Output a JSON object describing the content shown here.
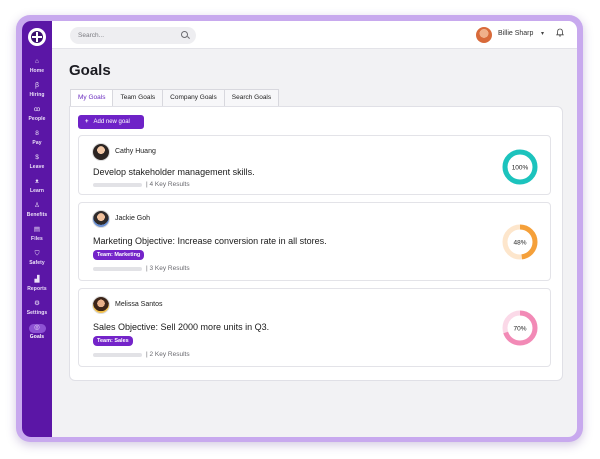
{
  "sidebar": {
    "items": [
      {
        "label": "Home",
        "icon": "home-icon",
        "glyph": "⌂"
      },
      {
        "label": "Hiring",
        "icon": "hiring-icon",
        "glyph": "ꞵ"
      },
      {
        "label": "People",
        "icon": "people-icon",
        "glyph": "ꝏ"
      },
      {
        "label": "Pay",
        "icon": "pay-icon",
        "glyph": "8"
      },
      {
        "label": "Leave",
        "icon": "leave-icon",
        "glyph": "$"
      },
      {
        "label": "Learn",
        "icon": "learn-icon",
        "glyph": "ᴥ"
      },
      {
        "label": "Benefits",
        "icon": "benefits-icon",
        "glyph": "♙"
      },
      {
        "label": "Files",
        "icon": "files-icon",
        "glyph": "▤"
      },
      {
        "label": "Safety",
        "icon": "safety-icon",
        "glyph": "⛉"
      },
      {
        "label": "Reports",
        "icon": "reports-icon",
        "glyph": "▟"
      },
      {
        "label": "Settings",
        "icon": "settings-icon",
        "glyph": "⚙"
      },
      {
        "label": "Goals",
        "icon": "goals-icon",
        "glyph": "◎"
      }
    ],
    "active": "Goals"
  },
  "topbar": {
    "search_placeholder": "Search...",
    "user_name": "Billie Sharp",
    "chevron": "▾",
    "bell": "🔔"
  },
  "page": {
    "title": "Goals",
    "tabs": [
      "My Goals",
      "Team Goals",
      "Company Goals",
      "Search Goals"
    ],
    "active_tab": "My Goals",
    "add_button": "Add new goal"
  },
  "goals": [
    {
      "owner": "Cathy Huang",
      "objective": "Develop stakeholder management skills.",
      "tag": "",
      "key_results": "4 Key Results",
      "progress": 100,
      "progress_label": "100%",
      "color": "#1cc3bd",
      "track": "#c9f1ef"
    },
    {
      "owner": "Jackie Goh",
      "objective": "Marketing Objective: Increase conversion rate in all stores.",
      "tag": "Team: Marketing",
      "key_results": "3 Key Results",
      "progress": 48,
      "progress_label": "48%",
      "color": "#f5a03a",
      "track": "#fde6cc"
    },
    {
      "owner": "Melissa Santos",
      "objective": "Sales Objective: Sell 2000 more units in Q3.",
      "tag": "Team: Sales",
      "key_results": "2 Key Results",
      "progress": 70,
      "progress_label": "70%",
      "color": "#f28ab6",
      "track": "#fbd9e8"
    }
  ],
  "colors": {
    "accent": "#6e22c7",
    "sidebar": "#5b16a6",
    "frame": "#c8a9ee"
  }
}
